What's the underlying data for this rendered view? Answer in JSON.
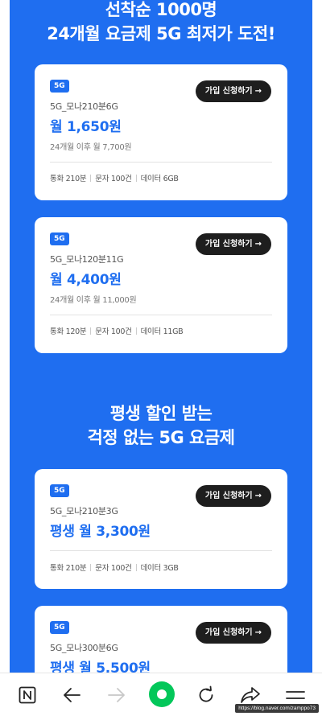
{
  "section1": {
    "heading_line1": "선착순 1000명",
    "heading_line2": "24개월 요금제 5G 최저가 도전!"
  },
  "section2": {
    "heading_line1": "평생 할인 받는",
    "heading_line2": "걱정 없는 5G 요금제"
  },
  "join_label": "가입 신청하기",
  "join_arrow": "→",
  "plans": [
    {
      "badge": "5G",
      "name": "5G_모나210분6G",
      "price": "월 1,650원",
      "after": "24개월 이후 월 7,700원",
      "specs": [
        "통화 210분",
        "문자 100건",
        "데이터 6GB"
      ]
    },
    {
      "badge": "5G",
      "name": "5G_모나120분11G",
      "price": "월 4,400원",
      "after": "24개월 이후 월 11,000원",
      "specs": [
        "통화 120분",
        "문자 100건",
        "데이터 11GB"
      ]
    },
    {
      "badge": "5G",
      "name": "5G_모나210분3G",
      "price": "평생 월 3,300원",
      "specs": [
        "통화 210분",
        "문자 100건",
        "데이터 3GB"
      ]
    },
    {
      "badge": "5G",
      "name": "5G_모나300분6G",
      "price": "평생 월 5,500원"
    }
  ],
  "nav": {
    "url_tooltip": "https://blog.naver.com/zamppo73",
    "icons": [
      "naver-home-icon",
      "back-arrow-icon",
      "forward-arrow-icon",
      "green-dot-icon",
      "refresh-icon",
      "share-icon",
      "menu-icon"
    ],
    "colors": {
      "accent": "#1f6ef0",
      "green": "#03c75a",
      "disabled": "#c8c8c8"
    }
  }
}
